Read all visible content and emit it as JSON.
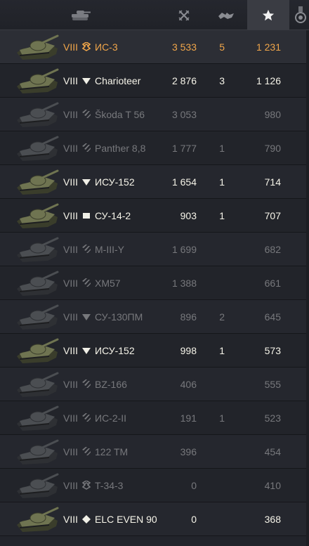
{
  "header": {
    "columns": [
      {
        "icon": "tank-icon",
        "active": false
      },
      {
        "icon": "crossed-swords-icon",
        "active": false
      },
      {
        "icon": "destroyed-tanks-icon",
        "active": false
      },
      {
        "icon": "star-icon",
        "active": true
      },
      {
        "icon": "medal-icon",
        "active": false
      }
    ]
  },
  "accent": "#f1a64a",
  "rows": [
    {
      "tier": "VIII",
      "class_icon": "medium-tank-icon",
      "name": "ИС-3",
      "c1": "3 533",
      "c2": "5",
      "c3": "1 231",
      "state": "self"
    },
    {
      "tier": "VIII",
      "class_icon": "td-icon",
      "name": "Charioteer",
      "c1": "2 876",
      "c2": "3",
      "c3": "1 126",
      "state": "top"
    },
    {
      "tier": "VIII",
      "class_icon": "heavy-tank-icon",
      "name": "Škoda T 56",
      "c1": "3 053",
      "c2": "",
      "c3": "980",
      "state": "dim"
    },
    {
      "tier": "VIII",
      "class_icon": "heavy-tank-icon",
      "name": "Panther 8,8",
      "c1": "1 777",
      "c2": "1",
      "c3": "790",
      "state": "dim"
    },
    {
      "tier": "VIII",
      "class_icon": "td-icon",
      "name": "ИСУ-152",
      "c1": "1 654",
      "c2": "1",
      "c3": "714",
      "state": "top"
    },
    {
      "tier": "VIII",
      "class_icon": "spg-icon",
      "name": "СУ-14-2",
      "c1": "903",
      "c2": "1",
      "c3": "707",
      "state": "top"
    },
    {
      "tier": "VIII",
      "class_icon": "heavy-tank-icon",
      "name": "M-III-Y",
      "c1": "1 699",
      "c2": "",
      "c3": "682",
      "state": "dim"
    },
    {
      "tier": "VIII",
      "class_icon": "heavy-tank-icon",
      "name": "XM57",
      "c1": "1 388",
      "c2": "",
      "c3": "661",
      "state": "dim"
    },
    {
      "tier": "VIII",
      "class_icon": "td-icon",
      "name": "СУ-130ПМ",
      "c1": "896",
      "c2": "2",
      "c3": "645",
      "state": "dim"
    },
    {
      "tier": "VIII",
      "class_icon": "td-icon",
      "name": "ИСУ-152",
      "c1": "998",
      "c2": "1",
      "c3": "573",
      "state": "top"
    },
    {
      "tier": "VIII",
      "class_icon": "heavy-tank-icon",
      "name": "BZ-166",
      "c1": "406",
      "c2": "",
      "c3": "555",
      "state": "dim"
    },
    {
      "tier": "VIII",
      "class_icon": "heavy-tank-icon",
      "name": "ИС-2-II",
      "c1": "191",
      "c2": "1",
      "c3": "523",
      "state": "dim"
    },
    {
      "tier": "VIII",
      "class_icon": "heavy-tank-icon",
      "name": "122 TM",
      "c1": "396",
      "c2": "",
      "c3": "454",
      "state": "dim"
    },
    {
      "tier": "VIII",
      "class_icon": "medium-tank-icon",
      "name": "T-34-3",
      "c1": "0",
      "c2": "",
      "c3": "410",
      "state": "dim"
    },
    {
      "tier": "VIII",
      "class_icon": "light-tank-icon",
      "name": "ELC EVEN 90",
      "c1": "0",
      "c2": "",
      "c3": "368",
      "state": "top"
    }
  ]
}
